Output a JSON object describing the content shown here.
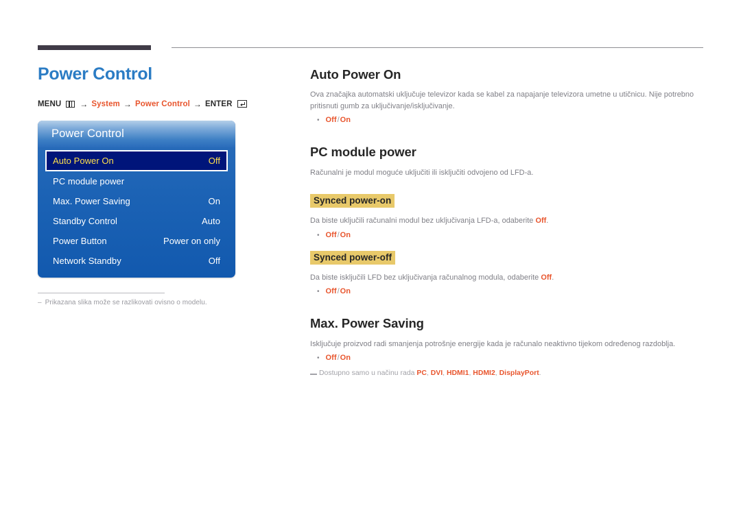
{
  "page": {
    "title": "Power Control"
  },
  "breadcrumb": {
    "menu_label": "MENU",
    "menu_icon": "menu-grid-icon",
    "arrow": "→",
    "step1": "System",
    "step2": "Power Control",
    "enter_label": "ENTER",
    "enter_icon": "enter-return-icon"
  },
  "osd": {
    "header": "Power Control",
    "rows": [
      {
        "label": "Auto Power On",
        "value": "Off",
        "selected": true
      },
      {
        "label": "PC module power",
        "value": "",
        "selected": false
      },
      {
        "label": "Max. Power Saving",
        "value": "On",
        "selected": false
      },
      {
        "label": "Standby Control",
        "value": "Auto",
        "selected": false
      },
      {
        "label": "Power Button",
        "value": "Power on only",
        "selected": false
      },
      {
        "label": "Network Standby",
        "value": "Off",
        "selected": false
      }
    ]
  },
  "left_note": {
    "dash": "–",
    "text": "Prikazana slika može se razlikovati ovisno o modelu."
  },
  "sections": {
    "auto_power_on": {
      "title": "Auto Power On",
      "body": "Ova značajka automatski uključuje televizor kada se kabel za napajanje televizora umetne u utičnicu. Nije potrebno pritisnuti gumb za uključivanje/isključivanje.",
      "option_off": "Off",
      "option_sep": "/",
      "option_on": "On"
    },
    "pc_module_power": {
      "title": "PC module power",
      "body": "Računalni je modul moguće uključiti ili isključiti odvojeno od LFD-a."
    },
    "synced_power_on": {
      "heading": "Synced power-on",
      "body_before": "Da biste uključili računalni modul bez uključivanja LFD-a, odaberite ",
      "body_accent": "Off",
      "body_after": ".",
      "option_off": "Off",
      "option_sep": "/",
      "option_on": "On"
    },
    "synced_power_off": {
      "heading": "Synced power-off",
      "body_before": "Da biste isključili LFD bez uključivanja računalnog modula, odaberite ",
      "body_accent": "Off",
      "body_after": ".",
      "option_off": "Off",
      "option_sep": "/",
      "option_on": "On"
    },
    "max_power_saving": {
      "title": "Max. Power Saving",
      "body": "Isključuje proizvod radi smanjenja potrošnje energije kada je računalo neaktivno tijekom određenog razdoblja.",
      "option_off": "Off",
      "option_sep": "/",
      "option_on": "On",
      "footnote_before": "Dostupno samo u načinu rada ",
      "footnote_modes": [
        "PC",
        "DVI",
        "HDMI1",
        "HDMI2",
        "DisplayPort"
      ],
      "footnote_after": "."
    }
  },
  "colors": {
    "accent_orange": "#e8552d",
    "title_blue": "#2b7cc4",
    "highlight_gold": "#e8c96a",
    "osd_blue": "#1c63b5",
    "osd_selected": "#00157a",
    "osd_selected_text": "#ffe04d"
  }
}
